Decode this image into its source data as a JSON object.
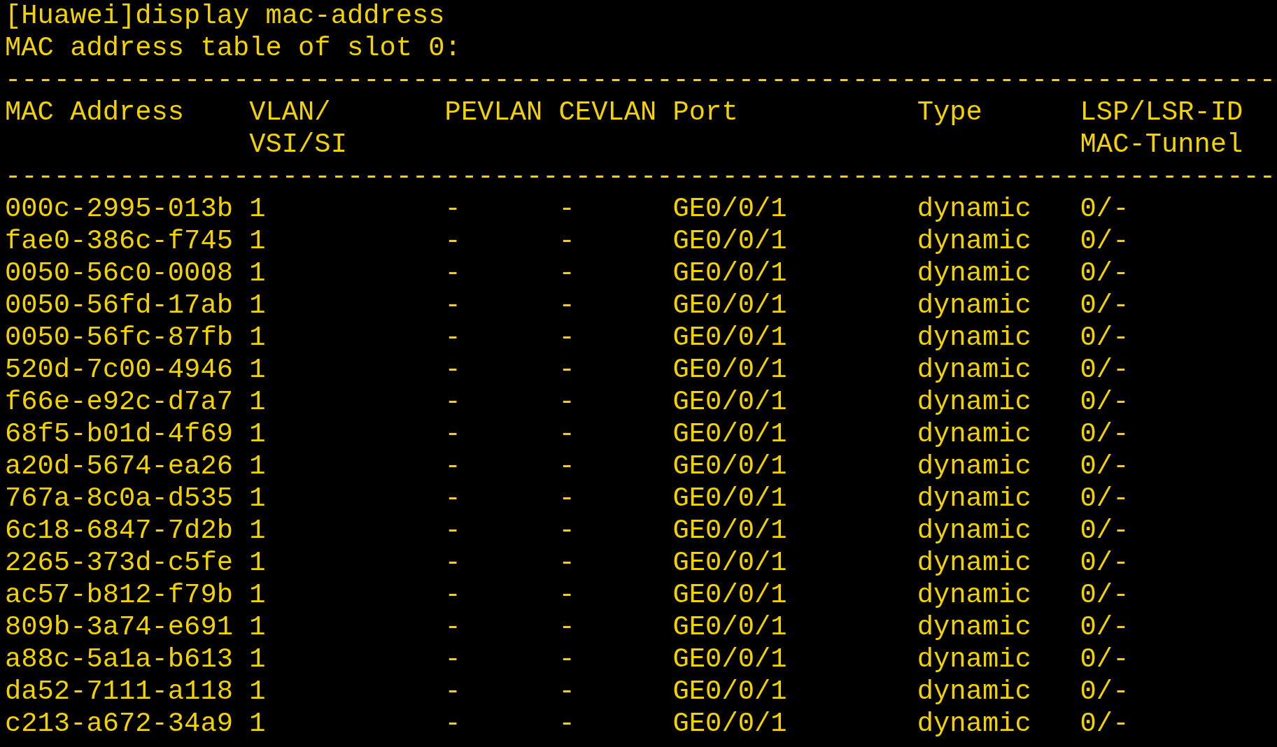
{
  "command_line": "[Huawei]display mac-address",
  "table_title": "MAC address table of slot 0:",
  "separator_top": "------------------------------------------------------------------------------",
  "table": {
    "columns": [
      {
        "lines": [
          "MAC Address"
        ]
      },
      {
        "lines": [
          "VLAN/",
          "VSI/SI"
        ]
      },
      {
        "lines": [
          "PEVLAN"
        ]
      },
      {
        "lines": [
          "CEVLAN"
        ]
      },
      {
        "lines": [
          "Port"
        ]
      },
      {
        "lines": [
          "Type"
        ]
      },
      {
        "lines": [
          "LSP/LSR-ID",
          "MAC-Tunnel"
        ]
      }
    ],
    "separator": "------------------------------------------------------------------------------",
    "rows": [
      [
        "000c-2995-013b",
        "1",
        "-",
        "-",
        "GE0/0/1",
        "dynamic",
        "0/-"
      ],
      [
        "fae0-386c-f745",
        "1",
        "-",
        "-",
        "GE0/0/1",
        "dynamic",
        "0/-"
      ],
      [
        "0050-56c0-0008",
        "1",
        "-",
        "-",
        "GE0/0/1",
        "dynamic",
        "0/-"
      ],
      [
        "0050-56fd-17ab",
        "1",
        "-",
        "-",
        "GE0/0/1",
        "dynamic",
        "0/-"
      ],
      [
        "0050-56fc-87fb",
        "1",
        "-",
        "-",
        "GE0/0/1",
        "dynamic",
        "0/-"
      ],
      [
        "520d-7c00-4946",
        "1",
        "-",
        "-",
        "GE0/0/1",
        "dynamic",
        "0/-"
      ],
      [
        "f66e-e92c-d7a7",
        "1",
        "-",
        "-",
        "GE0/0/1",
        "dynamic",
        "0/-"
      ],
      [
        "68f5-b01d-4f69",
        "1",
        "-",
        "-",
        "GE0/0/1",
        "dynamic",
        "0/-"
      ],
      [
        "a20d-5674-ea26",
        "1",
        "-",
        "-",
        "GE0/0/1",
        "dynamic",
        "0/-"
      ],
      [
        "767a-8c0a-d535",
        "1",
        "-",
        "-",
        "GE0/0/1",
        "dynamic",
        "0/-"
      ],
      [
        "6c18-6847-7d2b",
        "1",
        "-",
        "-",
        "GE0/0/1",
        "dynamic",
        "0/-"
      ],
      [
        "2265-373d-c5fe",
        "1",
        "-",
        "-",
        "GE0/0/1",
        "dynamic",
        "0/-"
      ],
      [
        "ac57-b812-f79b",
        "1",
        "-",
        "-",
        "GE0/0/1",
        "dynamic",
        "0/-"
      ],
      [
        "809b-3a74-e691",
        "1",
        "-",
        "-",
        "GE0/0/1",
        "dynamic",
        "0/-"
      ],
      [
        "a88c-5a1a-b613",
        "1",
        "-",
        "-",
        "GE0/0/1",
        "dynamic",
        "0/-"
      ],
      [
        "da52-7111-a118",
        "1",
        "-",
        "-",
        "GE0/0/1",
        "dynamic",
        "0/-"
      ],
      [
        "c213-a672-34a9",
        "1",
        "-",
        "-",
        "GE0/0/1",
        "dynamic",
        "0/-"
      ]
    ]
  }
}
